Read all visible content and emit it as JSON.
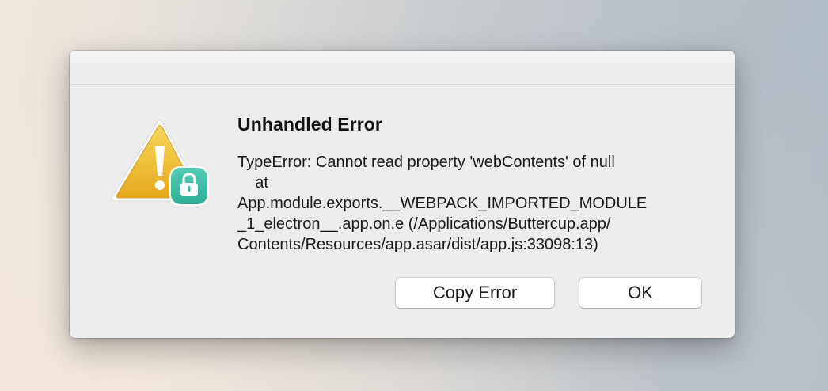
{
  "dialog": {
    "title": "Unhandled Error",
    "message": "TypeError: Cannot read property 'webContents' of null\n    at\nApp.module.exports.__WEBPACK_IMPORTED_MODULE\n_1_electron__.app.on.e (/Applications/Buttercup.app/\nContents/Resources/app.asar/dist/app.js:33098:13)",
    "icon": "caution-triangle-with-app-lock-badge",
    "buttons": {
      "copy_label": "Copy Error",
      "ok_label": "OK"
    }
  },
  "colors": {
    "warning_yellow": "#F2C230",
    "badge_teal": "#3DBEA8",
    "dialog_bg": "#ECECEC"
  }
}
